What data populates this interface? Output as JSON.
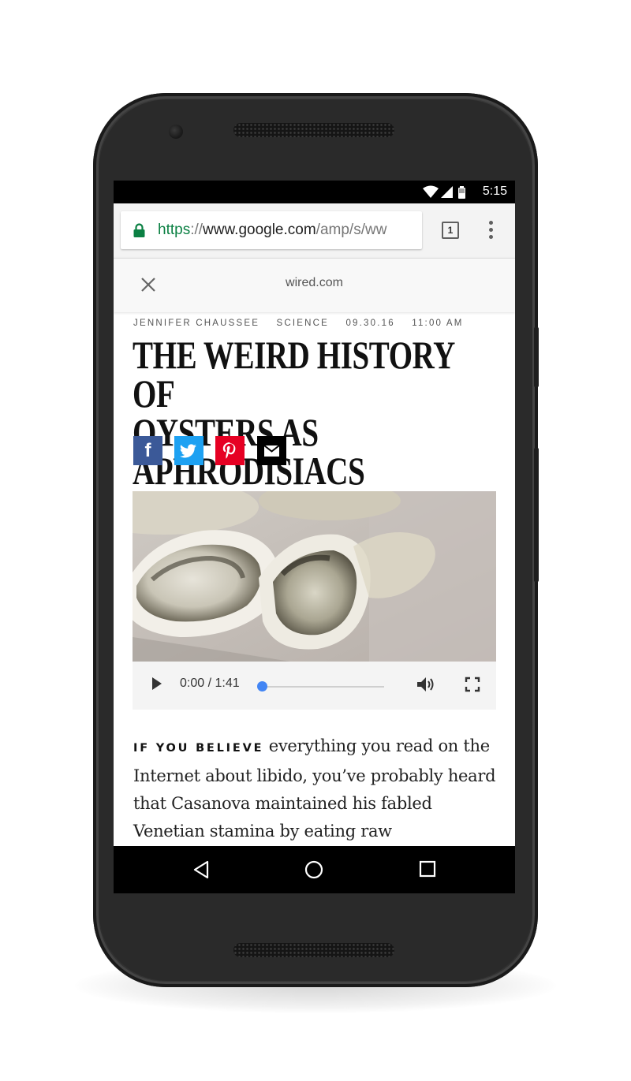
{
  "status_bar": {
    "time": "5:15"
  },
  "browser": {
    "url_scheme": "https",
    "url_sep": "://",
    "url_host": "www.google.com",
    "url_path": "/amp/s/ww",
    "tab_count": "1"
  },
  "amp_header": {
    "domain": "wired.com"
  },
  "article": {
    "byline": {
      "author": "JENNIFER CHAUSSEE",
      "section": "SCIENCE",
      "date": "09.30.16",
      "time": "11:00 AM"
    },
    "headline_line1": "THE WEIRD HISTORY OF",
    "headline_line2": "OYSTERS AS APHRODISIACS",
    "share_icons": [
      "facebook-icon",
      "twitter-icon",
      "pinterest-icon",
      "email-icon"
    ],
    "video": {
      "current_time": "0:00",
      "separator": "/",
      "duration": "1:41",
      "progress": 0
    },
    "lead_in": "IF YOU BELIEVE",
    "body": "everything you read on the Internet about libido, you’ve probably heard that Casanova maintained his fabled Venetian stamina by eating raw"
  },
  "colors": {
    "facebook": "#3b5998",
    "twitter": "#1da1f2",
    "pinterest": "#e60023",
    "email": "#000000",
    "url_scheme": "#0b8043",
    "progress_thumb": "#4285f4"
  }
}
